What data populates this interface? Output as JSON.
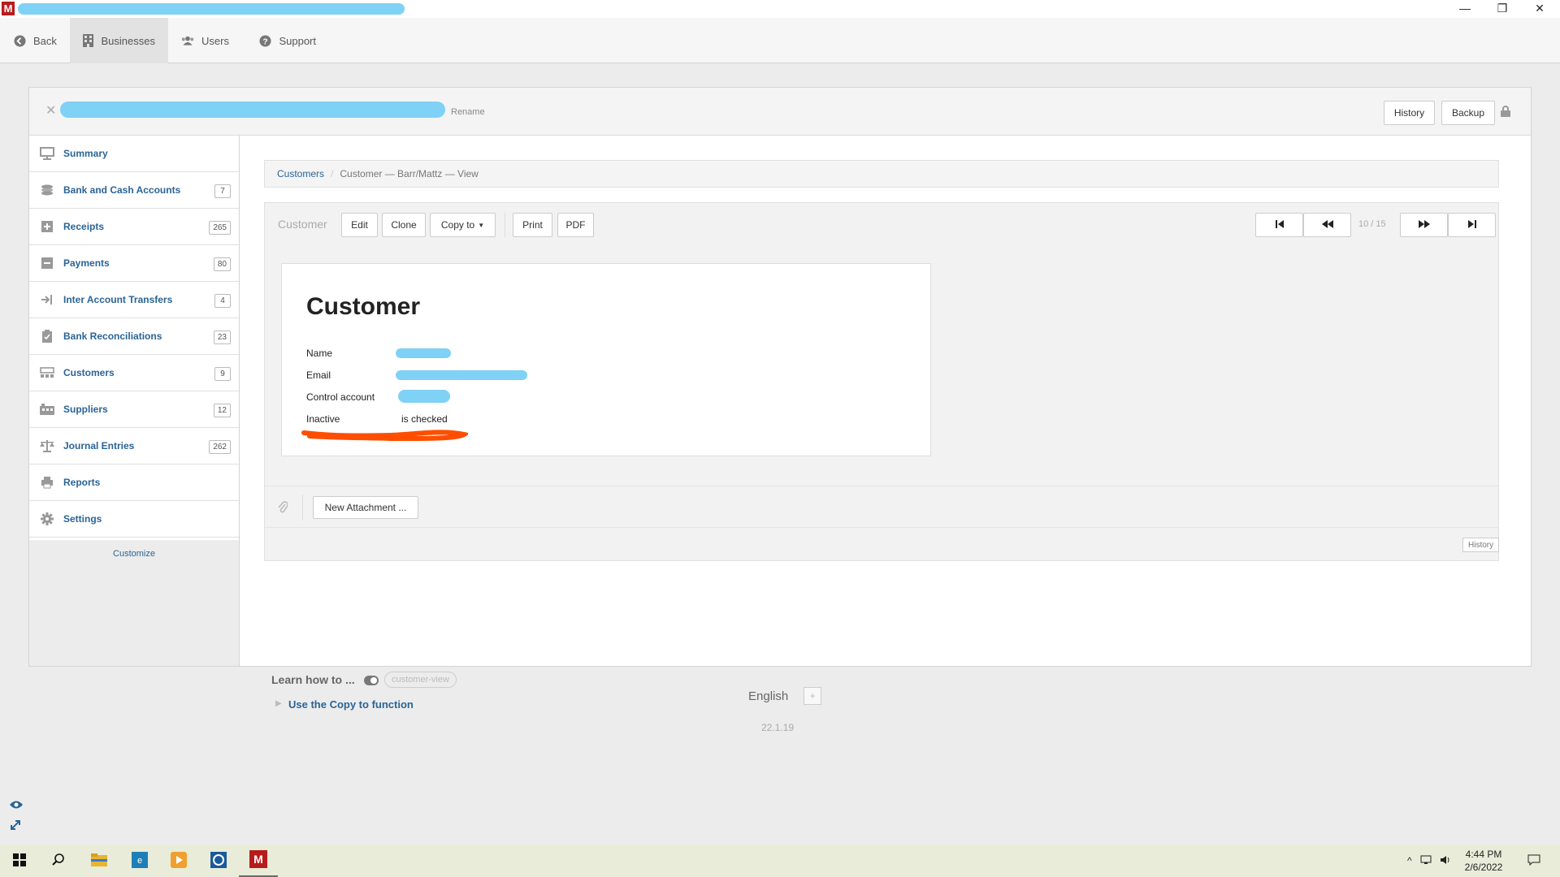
{
  "window": {
    "logo_letter": "M",
    "minimize_glyph": "—",
    "restore_glyph": "❐",
    "close_glyph": "✕"
  },
  "topnav": {
    "items": [
      {
        "label": "Back",
        "icon": "back-circle-icon"
      },
      {
        "label": "Businesses",
        "icon": "building-icon",
        "active": true
      },
      {
        "label": "Users",
        "icon": "users-icon"
      },
      {
        "label": "Support",
        "icon": "question-circle-icon"
      }
    ]
  },
  "business": {
    "close_glyph": "✕",
    "rename_label": "Rename",
    "history_label": "History",
    "backup_label": "Backup",
    "lock_icon": "lock-icon"
  },
  "sidebar": {
    "items": [
      {
        "label": "Summary",
        "icon": "monitor-icon",
        "count": ""
      },
      {
        "label": "Bank and Cash Accounts",
        "icon": "coins-icon",
        "count": "7"
      },
      {
        "label": "Receipts",
        "icon": "plus-square-icon",
        "count": "265"
      },
      {
        "label": "Payments",
        "icon": "minus-square-icon",
        "count": "80"
      },
      {
        "label": "Inter Account Transfers",
        "icon": "transfer-icon",
        "count": "4"
      },
      {
        "label": "Bank Reconciliations",
        "icon": "clipboard-check-icon",
        "count": "23"
      },
      {
        "label": "Customers",
        "icon": "customers-icon",
        "count": "9"
      },
      {
        "label": "Suppliers",
        "icon": "suppliers-icon",
        "count": "12"
      },
      {
        "label": "Journal Entries",
        "icon": "balance-scale-icon",
        "count": "262"
      },
      {
        "label": "Reports",
        "icon": "printer-icon",
        "count": ""
      },
      {
        "label": "Settings",
        "icon": "gear-icon",
        "count": ""
      }
    ],
    "customize_label": "Customize"
  },
  "breadcrumb": {
    "root": "Customers",
    "separator": "/",
    "current": "Customer — Barr/Mattz — View"
  },
  "toolbar": {
    "label": "Customer",
    "edit": "Edit",
    "clone": "Clone",
    "copy_to": "Copy to",
    "print": "Print",
    "pdf": "PDF",
    "pager": "10 / 15"
  },
  "document": {
    "title": "Customer",
    "fields": [
      {
        "label": "Name",
        "value": ""
      },
      {
        "label": "Email",
        "value": ""
      },
      {
        "label": "Control account",
        "value": ""
      },
      {
        "label": "Inactive",
        "value": "is checked"
      }
    ]
  },
  "attachments": {
    "new_label": "New Attachment ...",
    "history_label": "History"
  },
  "learn": {
    "label": "Learn how to ...",
    "tag": "customer-view",
    "link": "Use the Copy to function"
  },
  "footer": {
    "language": "English",
    "plus": "+",
    "version": "22.1.19"
  },
  "taskbar": {
    "time": "4:44 PM",
    "date": "2/6/2022"
  },
  "colors": {
    "link": "#2a6496",
    "brand": "#b71c1c",
    "redaction": "#7fd1f5",
    "annotation": "#ff4e00"
  }
}
